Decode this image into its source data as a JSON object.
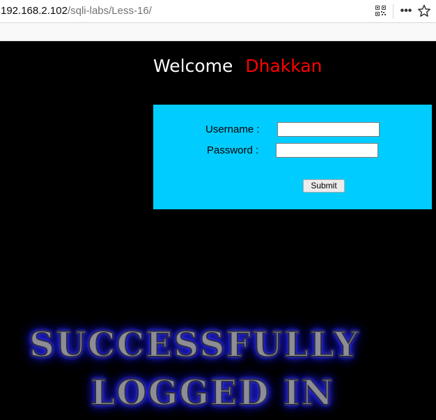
{
  "browser": {
    "url_host": "192.168.2.102",
    "url_path": "/sqli-labs/Less-16/",
    "more_glyph": "•••",
    "icons": [
      "qr-code-icon",
      "more-icon",
      "bookmark-star-icon"
    ]
  },
  "page": {
    "welcome_text": "Welcome",
    "welcome_name": "Dhakkan",
    "form": {
      "username_label": "Username :",
      "password_label": "Password :",
      "username_value": "",
      "password_value": "",
      "submit_label": "Submit"
    },
    "result": {
      "line1": "SUCCESSFULLY",
      "line2": "LOGGED IN"
    }
  },
  "colors": {
    "background": "#000000",
    "form_background": "#00ccff",
    "welcome_name_color": "#ff0000",
    "banner_glow": "#2a2aff"
  }
}
